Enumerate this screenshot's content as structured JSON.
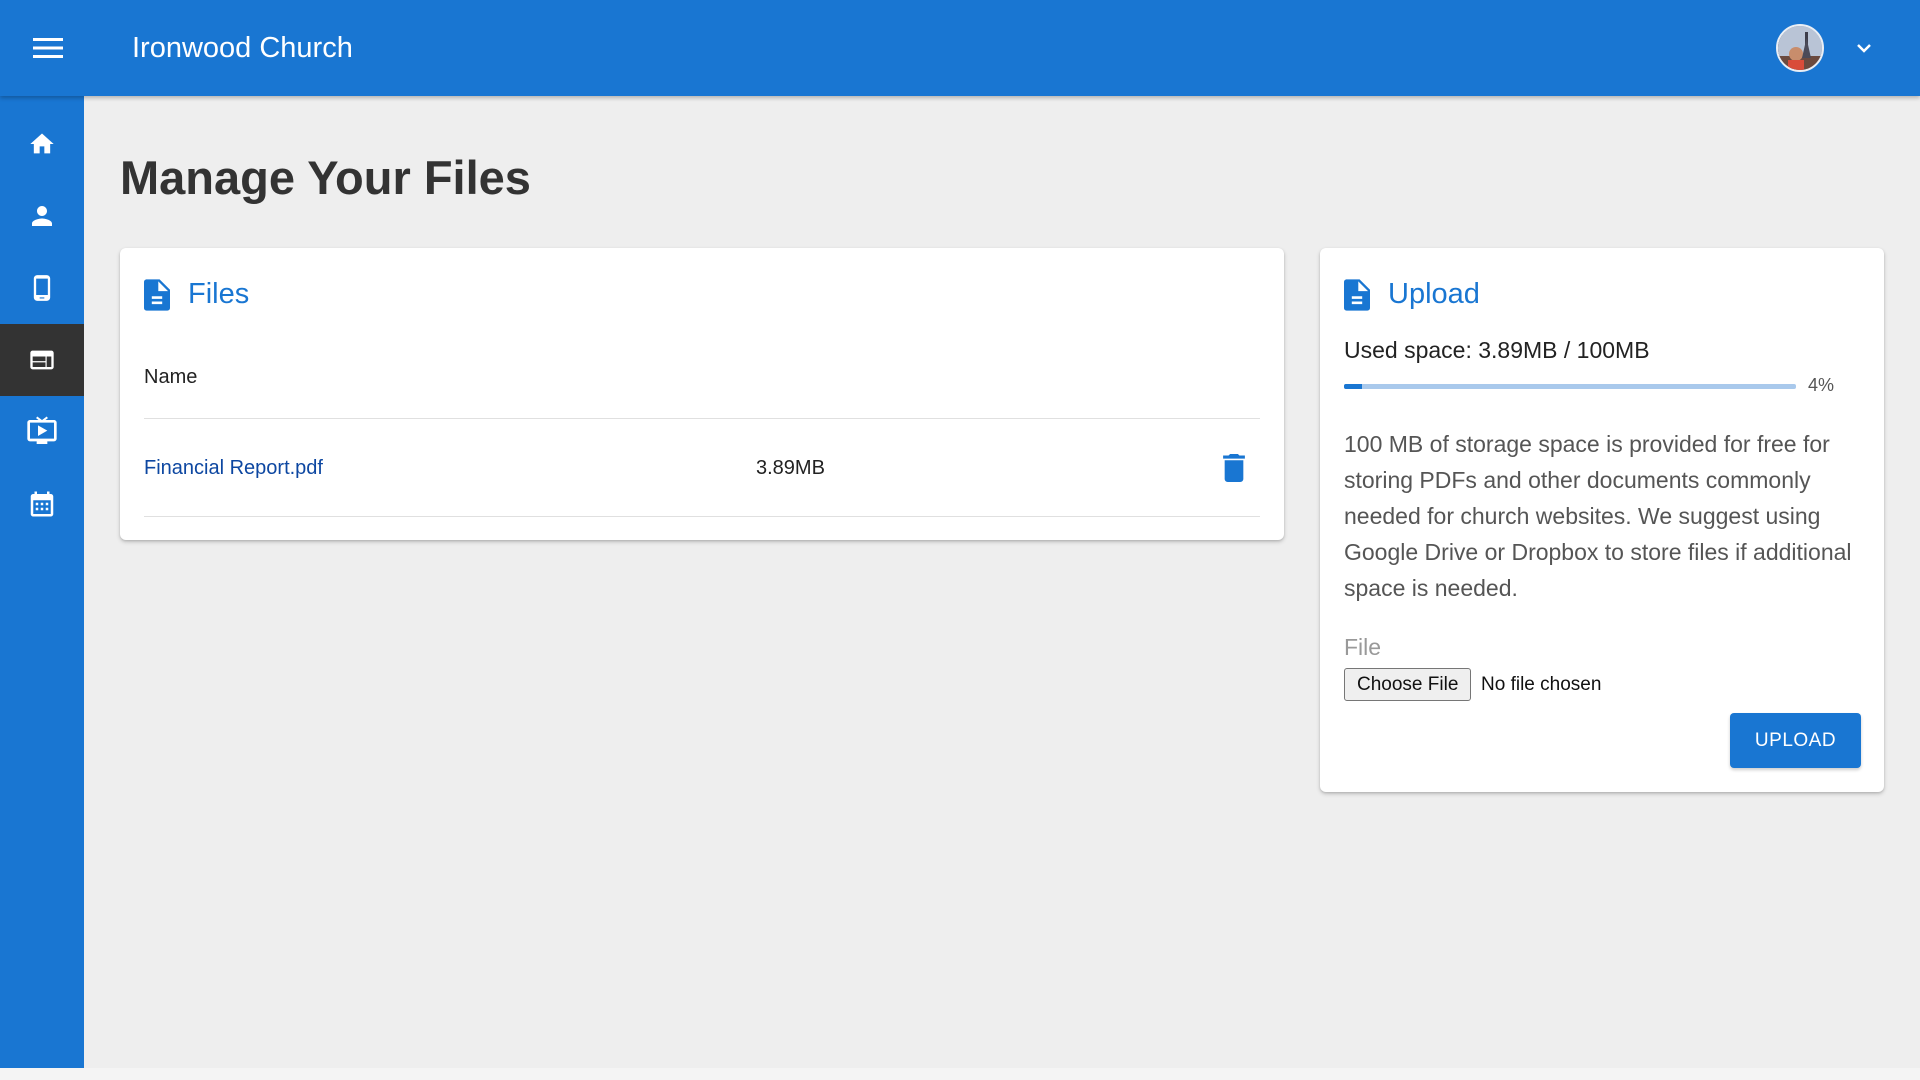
{
  "header": {
    "title": "Ironwood Church",
    "menu_icon": "hamburger-menu-icon",
    "avatar_icon": "user-avatar",
    "dropdown_icon": "chevron-down-icon"
  },
  "sidebar": {
    "items": [
      {
        "name": "home",
        "icon": "home-icon",
        "active": false
      },
      {
        "name": "people",
        "icon": "person-icon",
        "active": false
      },
      {
        "name": "mobile",
        "icon": "phone-icon",
        "active": false
      },
      {
        "name": "website",
        "icon": "web-layout-icon",
        "active": true
      },
      {
        "name": "streaming",
        "icon": "tv-play-icon",
        "active": false
      },
      {
        "name": "calendar",
        "icon": "calendar-icon",
        "active": false
      }
    ]
  },
  "page": {
    "title": "Manage Your Files"
  },
  "files_card": {
    "title": "Files",
    "icon": "document-icon",
    "column_name": "Name",
    "rows": [
      {
        "name": "Financial Report.pdf",
        "size": "3.89MB",
        "action_icon": "trash-icon"
      }
    ]
  },
  "upload_card": {
    "title": "Upload",
    "icon": "document-icon",
    "used_space": "Used space: 3.89MB / 100MB",
    "progress_percent": 4,
    "progress_label": "4%",
    "help_text": "100 MB of storage space is provided for free for storing PDFs and other documents commonly needed for church websites. We suggest using Google Drive or Dropbox to store files if additional space is needed.",
    "file_label": "File",
    "choose_file_label": "Choose File",
    "no_file_text": "No file chosen",
    "upload_button": "UPLOAD"
  },
  "colors": {
    "primary": "#1976d2",
    "sidebar_active": "#333333",
    "background": "#eeeeee",
    "link": "#0d47a1"
  }
}
